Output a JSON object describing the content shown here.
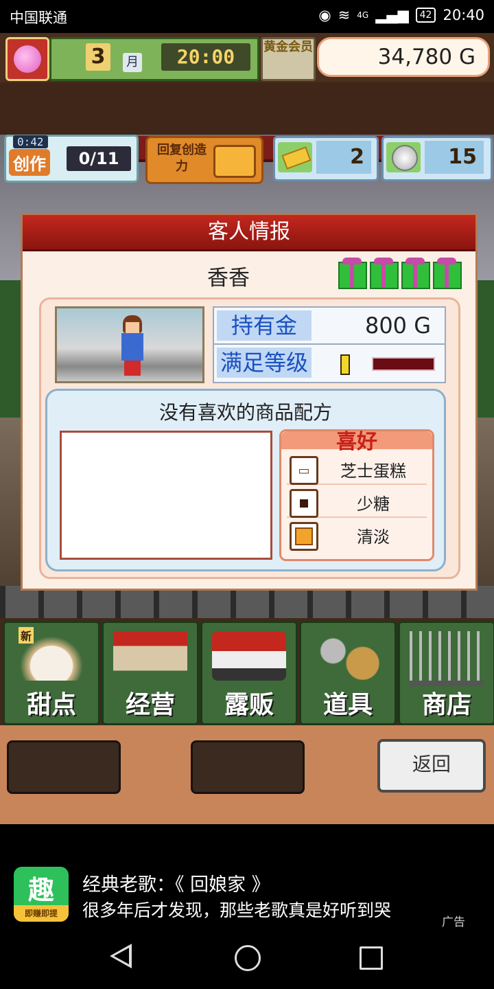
{
  "status_bar": {
    "carrier": "中国联通",
    "signal": "4G",
    "battery": "42",
    "time": "20:40"
  },
  "hud": {
    "month": "3",
    "month_label": "月",
    "game_time": "20:00",
    "gold_member": "黄金会员",
    "money": "34,780 G",
    "create_timer": "0:42",
    "create_label": "创作",
    "create_count": "0/11",
    "recover_label": "回复创造力",
    "tickets": "2",
    "medals": "15"
  },
  "dialog": {
    "title": "客人情报",
    "customer_name": "香香",
    "gift_count": 4,
    "money_label": "持有金",
    "money_value": "800 G",
    "satisfaction_label": "满足等级",
    "satisfaction_level": 0.05,
    "speech": "没有喜欢的商品配方",
    "preferences_title": "喜好",
    "preferences": [
      {
        "icon": "folder-icon",
        "label": "芝士蛋糕"
      },
      {
        "icon": "square-dot-icon",
        "label": "少糖"
      },
      {
        "icon": "cube-icon",
        "label": "清淡"
      }
    ]
  },
  "menu": [
    {
      "label": "甜点",
      "icon": "cake-icon",
      "badge": "新"
    },
    {
      "label": "经营",
      "icon": "shop-icon"
    },
    {
      "label": "露贩",
      "icon": "food-truck-icon"
    },
    {
      "label": "道具",
      "icon": "gear-bag-icon"
    },
    {
      "label": "商店",
      "icon": "cart-icon"
    }
  ],
  "back_button": "返回",
  "ad": {
    "app_icon_text": "趣",
    "app_icon_sub": "即赚即提",
    "title": "经典老歌：《 回娘家 》",
    "description": "很多年后才发现，那些老歌真是好听到哭",
    "tag": "广告"
  },
  "colors": {
    "header_red": "#c4271e",
    "menu_green": "#3f6a3a",
    "label_blue": "#1a50c0"
  }
}
